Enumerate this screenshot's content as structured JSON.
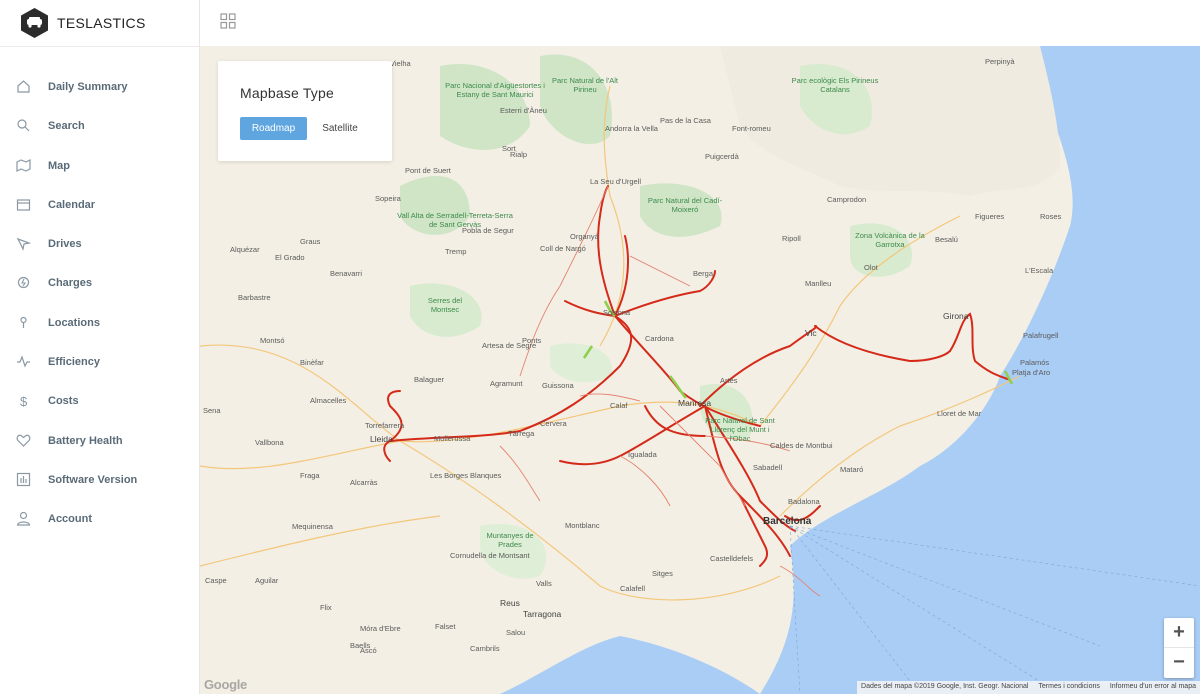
{
  "app": {
    "name": "TESLASTICS"
  },
  "sidebar": {
    "items": [
      {
        "label": "Daily Summary",
        "icon": "home-icon"
      },
      {
        "label": "Search",
        "icon": "search-icon"
      },
      {
        "label": "Map",
        "icon": "map-icon"
      },
      {
        "label": "Calendar",
        "icon": "calendar-icon"
      },
      {
        "label": "Drives",
        "icon": "drive-icon"
      },
      {
        "label": "Charges",
        "icon": "charge-icon"
      },
      {
        "label": "Locations",
        "icon": "location-icon"
      },
      {
        "label": "Efficiency",
        "icon": "pulse-icon"
      },
      {
        "label": "Costs",
        "icon": "dollar-icon"
      },
      {
        "label": "Battery Health",
        "icon": "heart-icon"
      },
      {
        "label": "Software Version",
        "icon": "chart-icon"
      },
      {
        "label": "Account",
        "icon": "user-icon"
      }
    ]
  },
  "mapbase": {
    "title": "Mapbase Type",
    "roadmap_label": "Roadmap",
    "satellite_label": "Satellite",
    "selected": "Roadmap"
  },
  "map": {
    "places_major": [
      "Barcelona",
      "Lleida",
      "Girona",
      "Tarragona",
      "Reus",
      "Manresa",
      "Vic"
    ],
    "places": [
      "Sabadell",
      "Badalona",
      "Mataró",
      "Castelldefels",
      "Sitges",
      "Calafell",
      "Valls",
      "Igualada",
      "Cervera",
      "Tàrrega",
      "Mollerussa",
      "Balaguer",
      "Agramunt",
      "Guissona",
      "Solsona",
      "Berga",
      "Ripoll",
      "Olot",
      "Figueres",
      "Roses",
      "L'Escala",
      "Palafrugell",
      "Palamós",
      "Platja d'Aro",
      "Lloret de Mar",
      "Manlleu",
      "Besalú",
      "Camprodon",
      "Puigcerdà",
      "La Seu d'Urgell",
      "Organyà",
      "Coll de Nargó",
      "Tremp",
      "Graus",
      "Benavarri",
      "Montsó",
      "Binèfar",
      "Barbastre",
      "Fraga",
      "Alcarràs",
      "Torrefarrera",
      "Les Borges Blanques",
      "Artesa de Segre",
      "Ponts",
      "Cardona",
      "Artés",
      "Salou",
      "Cambrils",
      "Perpinyà",
      "Andorra la Vella",
      "Pas de la Casa",
      "Font-romeu",
      "Vielha",
      "Sort",
      "Rialp",
      "Esterri d'Àneu",
      "Sopeira",
      "Pont de Suert",
      "Calaf",
      "Sena",
      "Almacelles",
      "Vallbona",
      "Mequinensa",
      "Flix",
      "Móra d'Ebre",
      "Falset",
      "Montblanc",
      "Cornudella de Montsant",
      "Ascó",
      "Caspe",
      "El Grado",
      "Alquézar",
      "Aguilar",
      "Pobla de Segur",
      "Baells",
      "Caldes de Montbui"
    ],
    "parks": [
      "Parc Nacional d'Aigüestortes i Estany de Sant Maurici",
      "Parc Natural de l'Alt Pirineu",
      "Parc ecològic Els Pirineus Catalans",
      "Parc Natural del Cadí-Moixeró",
      "Vall Alta de Serradell-Terreta-Serra de Sant Gervàs",
      "Serres del Montsec",
      "Zona Volcànica de la Garrotxa",
      "Parc Natural de Sant Llorenç del Munt i l'Obac",
      "Muntanyes de Prades"
    ],
    "zoom_in": "+",
    "zoom_out": "−",
    "google_logo": "Google",
    "attribution": [
      "Dades del mapa ©2019 Google, Inst. Geogr. Nacional",
      "Termes i condicions",
      "Informeu d'un error al mapa"
    ]
  },
  "colors": {
    "accent": "#5fa6e0",
    "route": "#d52a1a",
    "sea": "#a9cdf5",
    "land": "#f4f0e6",
    "park": "#cfe5c6"
  }
}
